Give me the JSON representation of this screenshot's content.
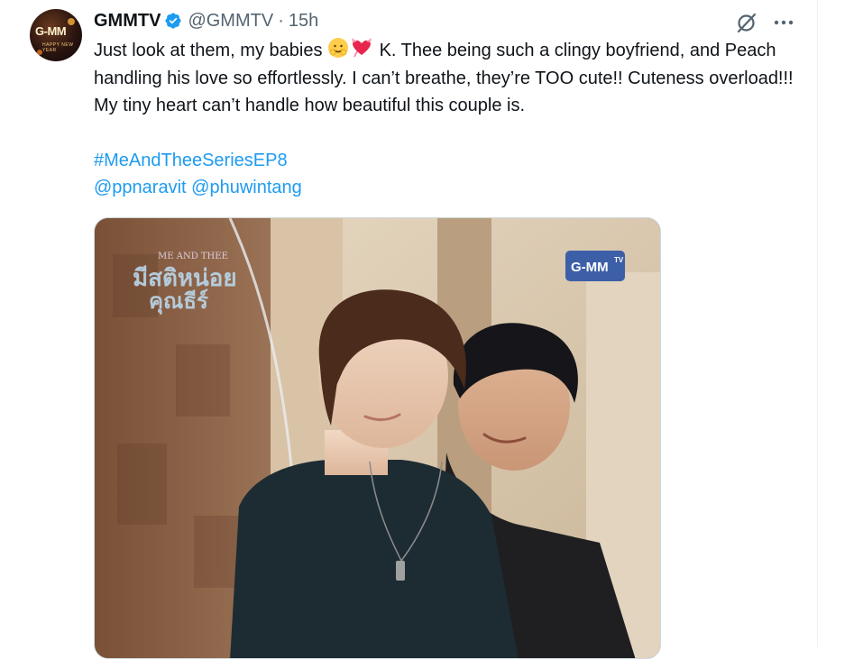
{
  "tweet": {
    "display_name": "GMMTV",
    "handle": "@GMMTV",
    "separator": "·",
    "time": "15h",
    "text_part1": "Just look at them, my babies ",
    "text_part2": " K. Thee being such a clingy boyfriend, and Peach handling his love so effortlessly. I can’t breathe, they’re TOO cute!! Cuteness overload!!! My tiny heart can’t handle how beautiful this couple is.",
    "hashtag": "#MeAndTheeSeriesEP8",
    "mention1": "@ppnaravit",
    "mention2": "@phuwintang",
    "verified_color": "#1d9bf0",
    "link_color": "#1d9bf0"
  },
  "avatar": {
    "logo_text": "G-MM",
    "sub_text": "HAPPY NEW YEAR"
  },
  "media": {
    "title_small": "ME AND THEE",
    "title_thai_line1": "มีสติหน่อย",
    "title_thai_line2": "คุณธีร์",
    "watermark": "G-MM",
    "watermark_tv": "TV"
  },
  "icons": {
    "verified": "verified-badge-icon",
    "grok": "grok-icon",
    "more": "more-options-icon",
    "emoji1": "smiling-face-emoji",
    "emoji2": "heart-with-ribbon-emoji"
  }
}
